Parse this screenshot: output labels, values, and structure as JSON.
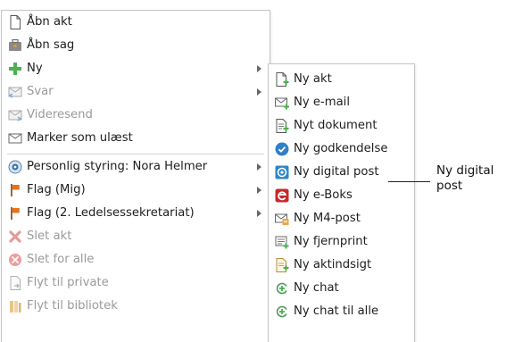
{
  "main_menu": {
    "items": [
      {
        "label": "Åbn akt",
        "icon": "document-icon",
        "disabled": false,
        "submenu": false
      },
      {
        "label": "Åbn sag",
        "icon": "case-icon",
        "disabled": false,
        "submenu": false
      },
      {
        "label": "Ny",
        "icon": "plus-icon",
        "disabled": false,
        "submenu": true
      },
      {
        "label": "Svar",
        "icon": "reply-icon",
        "disabled": true,
        "submenu": true
      },
      {
        "label": "Videresend",
        "icon": "forward-icon",
        "disabled": true,
        "submenu": false
      },
      {
        "label": "Marker som ulæst",
        "icon": "envelope-icon",
        "disabled": false,
        "submenu": false
      },
      {
        "label": "Personlig styring: Nora Helmer",
        "icon": "eye-icon",
        "disabled": false,
        "submenu": true
      },
      {
        "label": "Flag (Mig)",
        "icon": "flag-icon",
        "disabled": false,
        "submenu": true
      },
      {
        "label": "Flag (2. Ledelsessekretariat)",
        "icon": "flag-icon",
        "disabled": false,
        "submenu": true
      },
      {
        "label": "Slet akt",
        "icon": "x-icon",
        "disabled": true,
        "submenu": false
      },
      {
        "label": "Slet for alle",
        "icon": "circle-x-icon",
        "disabled": true,
        "submenu": false
      },
      {
        "label": "Flyt til private",
        "icon": "move-document-icon",
        "disabled": true,
        "submenu": false
      },
      {
        "label": "Flyt til bibliotek",
        "icon": "library-icon",
        "disabled": true,
        "submenu": false
      }
    ]
  },
  "sub_menu": {
    "items": [
      {
        "label": "Ny akt",
        "icon": "new-document-icon"
      },
      {
        "label": "Ny e-mail",
        "icon": "new-email-icon"
      },
      {
        "label": "Nyt dokument",
        "icon": "new-text-document-icon"
      },
      {
        "label": "Ny godkendelse",
        "icon": "approval-icon"
      },
      {
        "label": "Ny digital post",
        "icon": "digital-post-icon"
      },
      {
        "label": "Ny e-Boks",
        "icon": "eboks-icon"
      },
      {
        "label": "Ny M4-post",
        "icon": "m4-post-icon"
      },
      {
        "label": "Ny fjernprint",
        "icon": "remote-print-icon"
      },
      {
        "label": "Ny aktindsigt",
        "icon": "access-request-icon"
      },
      {
        "label": "Ny chat",
        "icon": "chat-icon"
      },
      {
        "label": "Ny chat til alle",
        "icon": "chat-all-icon"
      }
    ]
  },
  "callout": {
    "text": "Ny digital post"
  },
  "colors": {
    "plus_green": "#4caf50",
    "flag_orange": "#e8731f",
    "delete_red": "#e05a5a",
    "eboks_red": "#c62828",
    "approval_blue": "#2f80c8",
    "digital_post_blue": "#2d86c8"
  }
}
